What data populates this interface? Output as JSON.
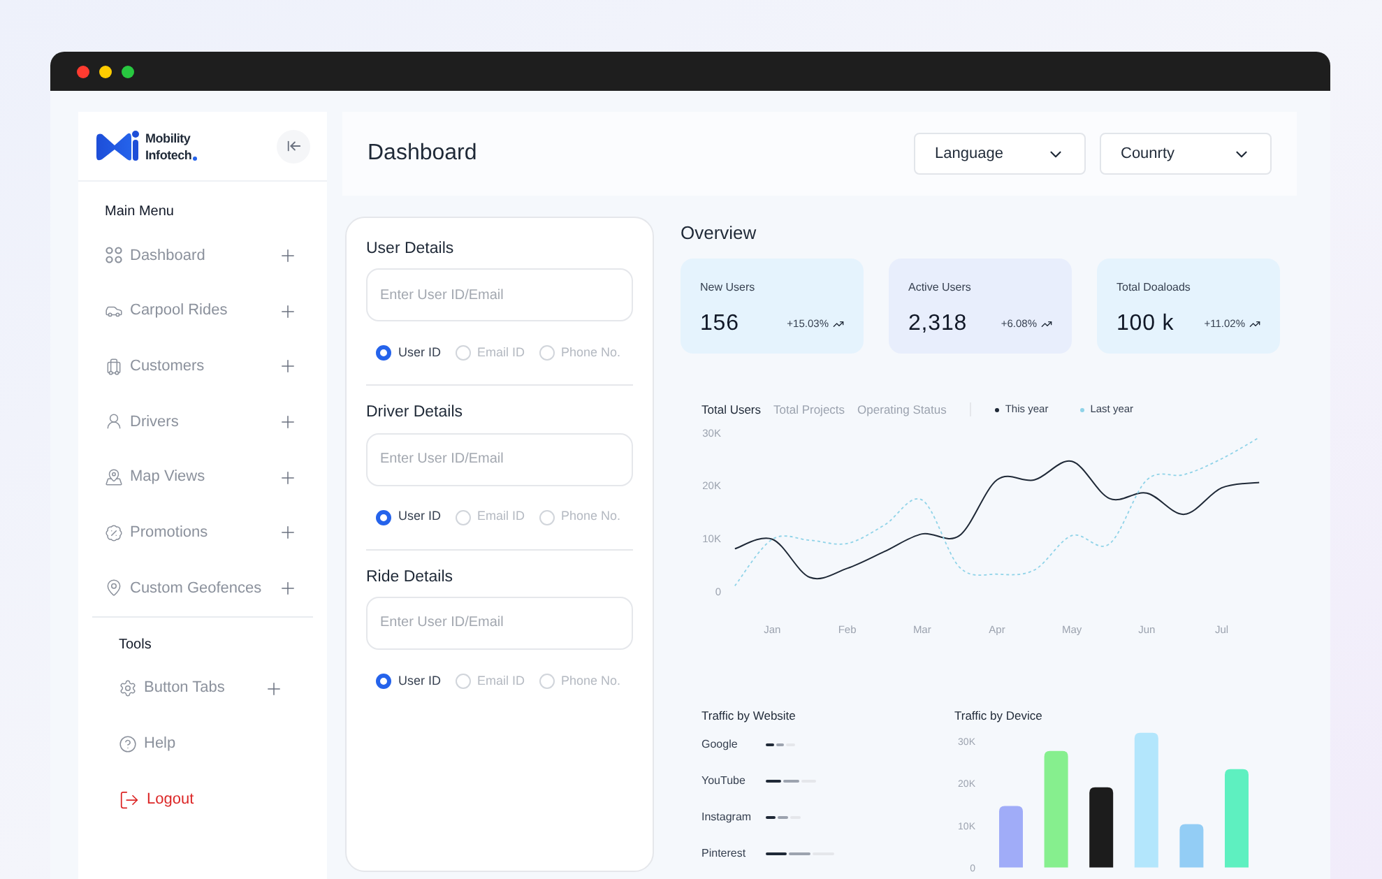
{
  "window": {
    "controls": [
      {
        "color": "#ff3b30"
      },
      {
        "color": "#ffcc00"
      },
      {
        "color": "#28c840"
      }
    ]
  },
  "sidebar": {
    "logo": {
      "line_1": "Mobility",
      "line_2": "Infotech"
    },
    "sections": [
      {
        "title": "Main Menu",
        "items": [
          {
            "label": "Dashboard",
            "expandable": true,
            "kind": "normal"
          },
          {
            "label": "Carpool Rides",
            "expandable": true,
            "kind": "normal"
          },
          {
            "label": "Customers",
            "expandable": true,
            "kind": "normal"
          },
          {
            "label": "Drivers",
            "expandable": true,
            "kind": "normal"
          },
          {
            "label": "Map Views",
            "expandable": true,
            "kind": "normal"
          },
          {
            "label": "Promotions",
            "expandable": true,
            "kind": "normal"
          },
          {
            "label": "Custom Geofences",
            "expandable": true,
            "kind": "normal"
          }
        ]
      },
      {
        "title": "Tools",
        "items": [
          {
            "label": "Button Tabs",
            "expandable": true,
            "kind": "normal"
          },
          {
            "label": "Help",
            "expandable": false,
            "kind": "normal"
          },
          {
            "label": "Logout",
            "expandable": false,
            "kind": "danger"
          }
        ]
      }
    ]
  },
  "header": {
    "title": "Dashboard",
    "dropdowns": [
      "Language",
      "Counrty"
    ]
  },
  "forms": [
    {
      "title": "User Details",
      "placeholder": "Enter User ID/Email",
      "options": [
        {
          "label": "User ID",
          "selected": true
        },
        {
          "label": "Email ID",
          "selected": false
        },
        {
          "label": "Phone No.",
          "selected": false
        }
      ]
    },
    {
      "title": "Driver Details",
      "placeholder": "Enter User ID/Email",
      "options": [
        {
          "label": "User ID",
          "selected": true
        },
        {
          "label": "Email ID",
          "selected": false
        },
        {
          "label": "Phone No.",
          "selected": false
        }
      ]
    },
    {
      "title": "Ride Details",
      "placeholder": "Enter User ID/Email",
      "options": [
        {
          "label": "User ID",
          "selected": true
        },
        {
          "label": "Email ID",
          "selected": false
        },
        {
          "label": "Phone No.",
          "selected": false
        }
      ]
    }
  ],
  "overview": {
    "title": "Overview",
    "cards": [
      {
        "label": "New Users",
        "value": "156",
        "change": "+15.03%",
        "color": "#e5f3fd"
      },
      {
        "label": "Active Users",
        "value": "2,318",
        "change": "+6.08%",
        "color": "#e8eefc"
      },
      {
        "label": "Total Doaloads",
        "value": "100 k",
        "change": "+11.02%",
        "color": "#e5f3fd"
      }
    ]
  },
  "users_chart": {
    "tabs": [
      {
        "label": "Total Users",
        "selected": true
      },
      {
        "label": "Total Projects",
        "selected": false
      },
      {
        "label": "Operating Status",
        "selected": false
      }
    ],
    "chart_data": {
      "type": "line",
      "categories": [
        null,
        "Jan",
        null,
        "Feb",
        null,
        "Mar",
        null,
        "Apr",
        null,
        "May",
        null,
        "Jun",
        null,
        "Jul",
        null
      ],
      "series": [
        {
          "name": "This year",
          "color": "#1f2937",
          "line_style": "solid",
          "values": [
            8000,
            9800,
            2600,
            4300,
            7500,
            10800,
            10500,
            21000,
            21000,
            24500,
            17500,
            18500,
            14500,
            19500,
            20500
          ]
        },
        {
          "name": "Last year",
          "color": "#8fd3e8",
          "line_style": "dashed",
          "values": [
            1000,
            9800,
            9600,
            9000,
            12500,
            17200,
            4500,
            3200,
            4000,
            10500,
            8900,
            21000,
            22000,
            25000,
            29000
          ]
        }
      ],
      "ylim": [
        0,
        30000
      ],
      "yticks": [
        {
          "value": 0,
          "label": "0"
        },
        {
          "value": 10000,
          "label": "10K"
        },
        {
          "value": 20000,
          "label": "20K"
        },
        {
          "value": 30000,
          "label": "30K"
        }
      ]
    }
  },
  "traffic_by_website": {
    "title": "Traffic by Website",
    "sites": [
      {
        "label": "Google"
      },
      {
        "label": "YouTube"
      },
      {
        "label": "Instagram"
      },
      {
        "label": "Pinterest"
      }
    ]
  },
  "traffic_by_device": {
    "title": "Traffic by Device",
    "chart_data": {
      "type": "bar",
      "categories": [
        null,
        null,
        null,
        null,
        null,
        null
      ],
      "values": [
        14500,
        27500,
        18900,
        31800,
        10200,
        23200
      ],
      "colors": [
        "#a0acf8",
        "#86ef8e",
        "#1c1c1c",
        "#b3e6fc",
        "#93cdf5",
        "#5ef0c0"
      ],
      "ylim": [
        0,
        33000
      ],
      "yticks": [
        {
          "value": 0,
          "label": "0"
        },
        {
          "value": 10000,
          "label": "10K"
        },
        {
          "value": 20000,
          "label": "20K"
        },
        {
          "value": 30000,
          "label": "30K"
        }
      ]
    }
  }
}
